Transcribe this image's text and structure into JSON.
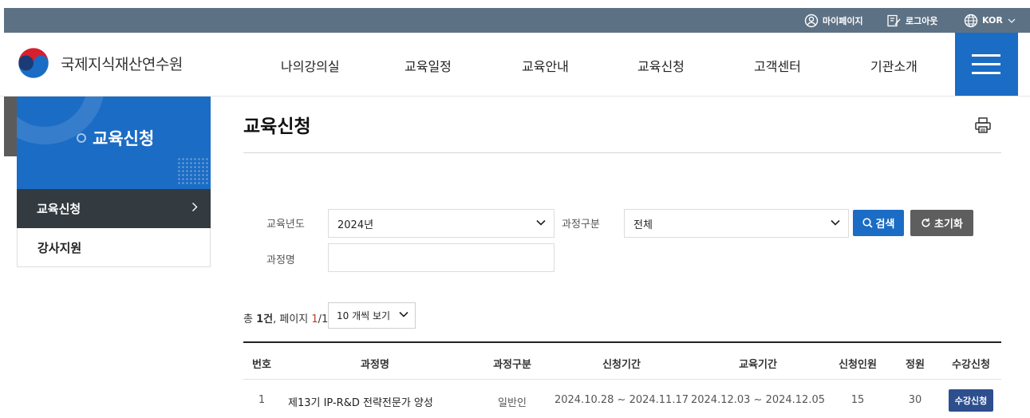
{
  "utility": {
    "mypage": "마이페이지",
    "logout": "로그아웃",
    "language": "KOR"
  },
  "header": {
    "logo_text": "국제지식재산연수원",
    "nav": [
      "나의강의실",
      "교육일정",
      "교육안내",
      "교육신청",
      "고객센터",
      "기관소개"
    ]
  },
  "sidebar": {
    "title": "교육신청",
    "items": [
      {
        "label": "교육신청",
        "active": true
      },
      {
        "label": "강사지원",
        "active": false
      }
    ]
  },
  "main": {
    "page_title": "교육신청",
    "filters": {
      "year_label": "교육년도",
      "year_value": "2024년",
      "category_label": "과정구분",
      "category_value": "전체",
      "course_label": "과정명",
      "course_value": "",
      "search_button": "검색",
      "reset_button": "초기화"
    },
    "summary": {
      "prefix": "총 ",
      "count": "1건",
      "page_text": ", 페이지 ",
      "page_current": "1",
      "page_total": "/1"
    },
    "per_page": "10 개씩 보기",
    "table": {
      "headers": [
        "번호",
        "과정명",
        "과정구분",
        "신청기간",
        "교육기간",
        "신청인원",
        "정원",
        "수강신청"
      ],
      "rows": [
        {
          "no": "1",
          "course": "제13기 IP-R&D 전략전문가 양성",
          "category": "일반인",
          "apply_period": "2024.10.28 ~ 2024.11.17",
          "edu_period": "2024.12.03 ~ 2024.12.05",
          "applicants": "15",
          "capacity": "30",
          "action": "수강신청"
        }
      ]
    }
  },
  "colors": {
    "primary": "#1b6cc4",
    "utility_bar": "#5d7184",
    "sidebar_active": "#333a40",
    "reset_button": "#5e5e5e",
    "enroll_button": "#2d4f8e"
  }
}
